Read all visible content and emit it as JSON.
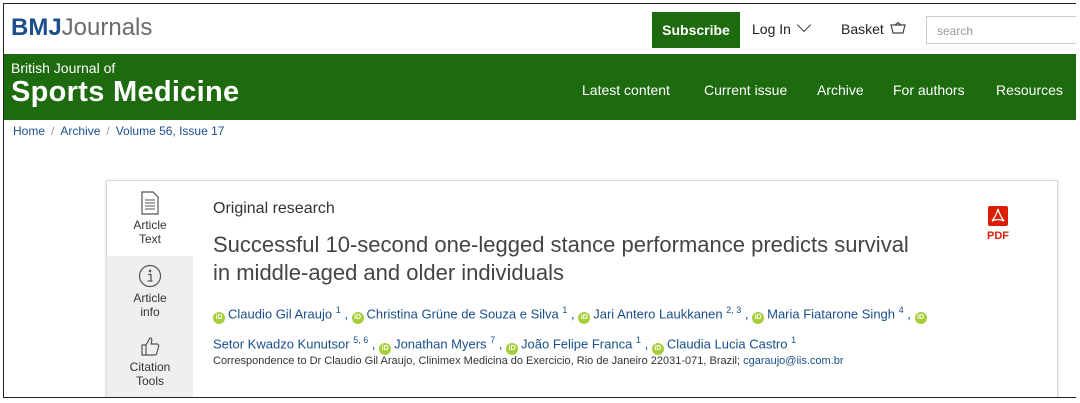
{
  "header": {
    "logo_bold": "BMJ",
    "logo_rest": "Journals",
    "subscribe_label": "Subscribe",
    "login_label": "Log In",
    "basket_label": "Basket",
    "search_placeholder": "search"
  },
  "journal": {
    "subtitle": "British Journal of",
    "name": "Sports Medicine",
    "nav": [
      "Latest content",
      "Current issue",
      "Archive",
      "For authors",
      "Resources"
    ]
  },
  "breadcrumb": [
    "Home",
    "Archive",
    "Volume 56, Issue 17"
  ],
  "sidebar": {
    "tabs": [
      {
        "line1": "Article",
        "line2": "Text"
      },
      {
        "line1": "Article",
        "line2": "info"
      },
      {
        "line1": "Citation",
        "line2": "Tools"
      }
    ]
  },
  "article": {
    "type": "Original research",
    "title": "Successful 10-second one-legged stance performance predicts survival in middle-aged and older individuals",
    "authors": [
      {
        "name": "Claudio Gil Araujo",
        "aff": "1"
      },
      {
        "name": "Christina Grüne de Souza e Silva",
        "aff": "1"
      },
      {
        "name": "Jari Antero Laukkanen",
        "aff": "2, 3"
      },
      {
        "name": "Maria Fiatarone Singh",
        "aff": "4"
      },
      {
        "name": "Setor Kwadzo Kunutsor",
        "aff": "5, 6"
      },
      {
        "name": "Jonathan Myers",
        "aff": "7"
      },
      {
        "name": "João Felipe Franca",
        "aff": "1"
      },
      {
        "name": "Claudia Lucia Castro",
        "aff": "1"
      }
    ],
    "correspondence": "Correspondence to Dr Claudio Gil Araujo, Clinimex Medicina do Exercicio, Rio de Janeiro 22031-071, Brazil;",
    "email": "cgaraujo@iis.com.br",
    "pdf_label": "PDF"
  },
  "colors": {
    "brand_green": "#1e6b0f",
    "link_blue": "#1a4f8b",
    "pdf_red": "#d81e05",
    "orcid_green": "#a6ce39"
  }
}
